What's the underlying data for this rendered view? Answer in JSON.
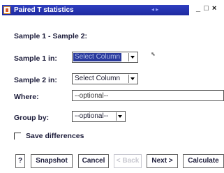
{
  "window": {
    "title": "Paired T statistics",
    "controls": {
      "minimize": "_",
      "maximize": "□",
      "close": "×"
    }
  },
  "form": {
    "heading": "Sample 1 - Sample 2:",
    "sample1": {
      "label": "Sample 1 in:",
      "value": "Select Column",
      "selected": true
    },
    "sample2": {
      "label": "Sample 2 in:",
      "value": "Select Column"
    },
    "where": {
      "label": "Where:",
      "value": "--optional--"
    },
    "group_by": {
      "label": "Group by:",
      "value": "--optional--"
    },
    "save_differences": {
      "label": "Save differences",
      "checked": false
    }
  },
  "buttons": {
    "help": "?",
    "snapshot": "Snapshot",
    "cancel": "Cancel",
    "back": "< Back",
    "next": "Next >",
    "calculate": "Calculate"
  },
  "colors": {
    "title_bar": "#2f3fc0",
    "selection": "#2a3a9c"
  }
}
